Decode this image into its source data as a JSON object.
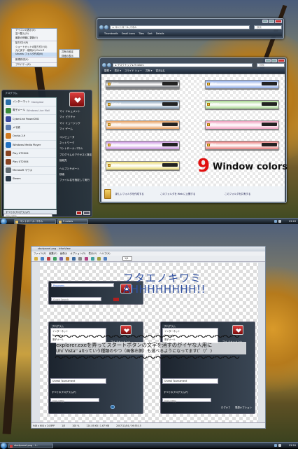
{
  "top_screen": {
    "start_menu": {
      "header": "プログラム",
      "pinned": [
        {
          "label": "インターネット",
          "sub": "Navigator",
          "color": "#2a6ea8"
        },
        {
          "label": "電子メール",
          "sub": "Windows Live Mail",
          "color": "#3a8a3a"
        }
      ],
      "recent": [
        {
          "label": "CyberLink PowerDVD",
          "color": "#3a4aa0"
        },
        {
          "label": "メモ帳",
          "color": "#5a7ab0"
        },
        {
          "label": "Orchis 2.9",
          "color": "#d07a20"
        },
        {
          "label": "Windows Media Player",
          "color": "#2070c0"
        },
        {
          "label": "Play UT2004",
          "color": "#884422"
        },
        {
          "label": "Play UT2004",
          "color": "#884422"
        },
        {
          "label": "Microsoft マウス",
          "color": "#606a70"
        },
        {
          "label": "Steam",
          "color": "#2a3a4a"
        }
      ],
      "all_programs": "すべてのプログラム(P)",
      "search_placeholder": "検索の開始",
      "right_items": [
        "マイ ドキュメント",
        "マイ ピクチャ",
        "マイ ミュージック",
        "マイ ゲーム",
        "",
        "コンピュータ",
        "ネットワーク",
        "コントロール パネル",
        "プログラムのアクセスと既定の設定",
        "接続先",
        "",
        "ヘルプとサポート",
        "検索",
        "ファイル名を指定して実行"
      ]
    },
    "context_menu": {
      "items": [
        "アイコンの表示(V)",
        "並べ替え(O)",
        "最新の情報に更新(E)",
        "",
        "貼り付け(P)",
        "ショートカットの貼り付け(S)",
        "元に戻す - 削除(U)   Ctrl+Z",
        "Ubuntu フォルダ作成(N)",
        "",
        "新規作成(X)",
        "",
        "プロパティ(R)"
      ],
      "selected_index": 7,
      "submenu": [
        "共有の設定",
        "詳細の表示"
      ]
    },
    "control_panel_window": {
      "title": "",
      "address": "▸ コントロール パネル",
      "search": "検索",
      "toolbar": [
        "Thumbnails",
        "Small Icons",
        "Tiles",
        "Sort",
        "Details"
      ]
    },
    "explorer_window": {
      "address": "▸ デスクトップ ▸ 9 colors",
      "search": "検索",
      "toolbar": [
        "整理 ▾",
        "表示 ▾",
        "スライド ショー",
        "共有 ▾",
        "書き込む"
      ],
      "swatches_left": [
        {
          "label": "Black",
          "color": "#5c6066"
        },
        {
          "label": "Default",
          "color": "#7f9ab4"
        },
        {
          "label": "Orange",
          "color": "#e8a060"
        },
        {
          "label": "Purple",
          "color": "#c890e0"
        },
        {
          "label": "Yellow",
          "color": "#e8d870"
        }
      ],
      "swatches_right": [
        {
          "label": "Blue",
          "color": "#8aa8e8"
        },
        {
          "label": "Green",
          "color": "#a8d890"
        },
        {
          "label": "Pink",
          "color": "#f0a0c0"
        },
        {
          "label": "Red",
          "color": "#e87a7a"
        }
      ],
      "big_number": "9",
      "big_text": "Window colors",
      "footer_links": [
        "新しいフォルダを作成する",
        "このフォルダを Web に公開する",
        "このフォルダを共有する"
      ]
    },
    "taskbar": {
      "buttons": [
        "コントロール パネル",
        "9 colors"
      ],
      "clock": "13:20"
    }
  },
  "bottom_screen": {
    "viewer_window": {
      "title": "startpanel.png - IrfanView",
      "menu": [
        "ファイル(F)",
        "編集(E)",
        "画像(I)",
        "オプション(O)",
        "表示(V)",
        "ヘルプ(H)"
      ],
      "zoom": "1/5",
      "headline_1": "フタエノキワミ",
      "headline_2": "AHHHHHHHH!!",
      "panel_top_header": "Programs",
      "panel_top_search": "Quick Search",
      "panel_a_header": "プログラム",
      "panel_b_header": "プログラム",
      "panel_right_items": [
        "マイ ドキュメント",
        "マイ ピクチャ",
        "マイ ミュージック"
      ],
      "panel_items": [
        "インターネット",
        "Navigator",
        "電子メール"
      ],
      "wave": "〜〜〜〜〜〜〜〜〜〜〜〜〜〜〜〜〜〜〜〜〜〜",
      "note_line_1": "explorer.exeを弄ってスタートボタンの文字を消すのがイヤな人用に",
      "note_line_2": "Uhi`Vista'' altっていう種類のやつ（画像右側）も選べるようになってます(゜▽゜)",
      "panel_bottom_item": "Unreal Tournament",
      "panel_all": "すべてのプログラム(P)",
      "panel_search": "検索の開始",
      "panel_logoff": "ログオフ",
      "panel_switch": "電源オプション",
      "status": [
        "946 x 604 x 24 BPP",
        "1/5",
        "100 %",
        "124.05 KB / 1.67 MB",
        "2007/11/04 / 09:55:15"
      ]
    },
    "taskbar": {
      "buttons": [
        "startpanel.png - I..."
      ],
      "clock": "13:20"
    }
  }
}
